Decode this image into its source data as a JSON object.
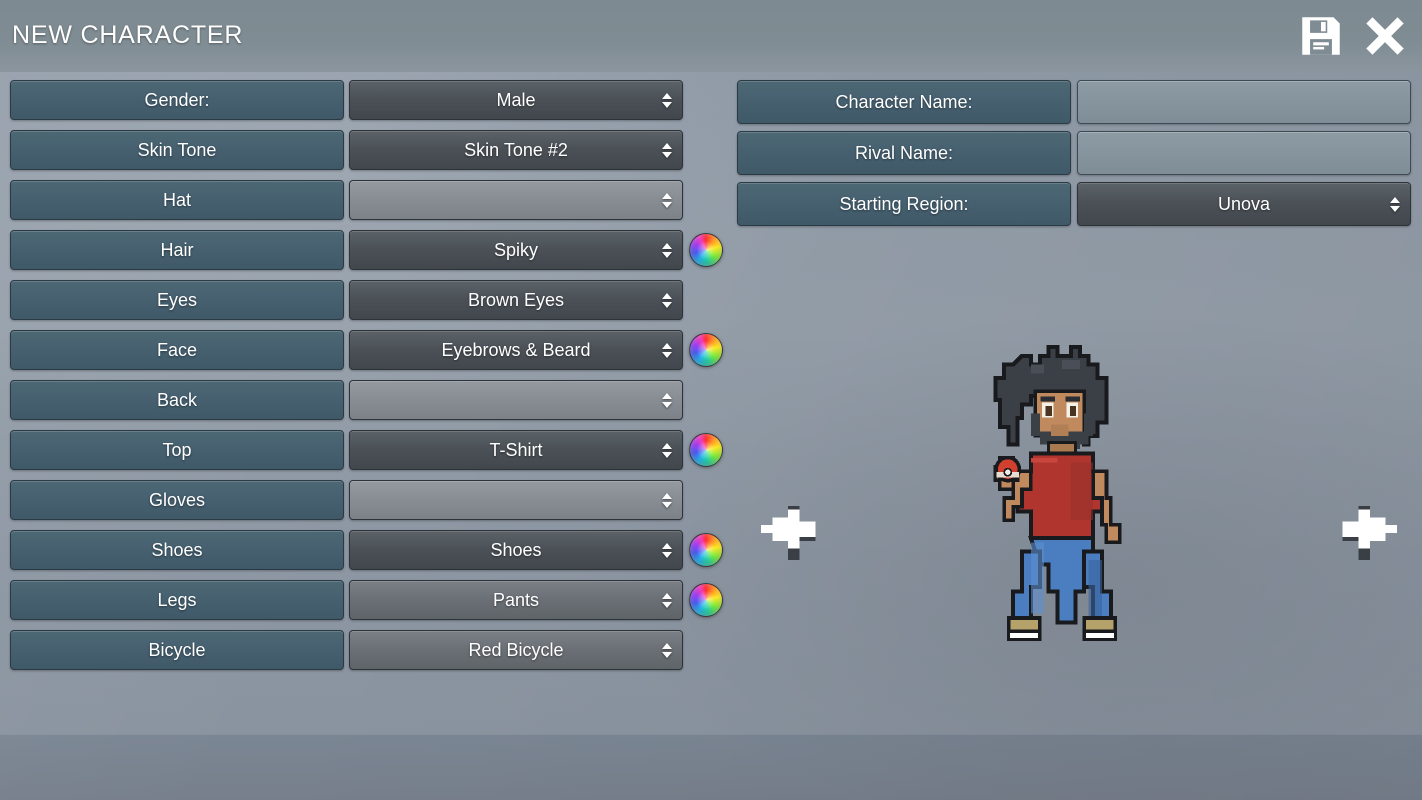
{
  "header": {
    "title": "NEW CHARACTER",
    "save_icon": "floppy-disk-save-icon",
    "close_icon": "close-x-icon"
  },
  "theme": {
    "label_button_color": "#466070",
    "select_color": "#4b5157",
    "select_empty_color": "#878d93",
    "text_input_color": "#86949e",
    "header_color": "#7f8c93",
    "background_color": "#949ea9",
    "floor_color": "#777f8c",
    "text_color": "#ffffff"
  },
  "appearance_rows": [
    {
      "label": "Gender:",
      "value": "Male",
      "empty": false,
      "light": false,
      "color_wheel": false
    },
    {
      "label": "Skin Tone",
      "value": "Skin Tone #2",
      "empty": false,
      "light": false,
      "color_wheel": false
    },
    {
      "label": "Hat",
      "value": "",
      "empty": true,
      "light": false,
      "color_wheel": false
    },
    {
      "label": "Hair",
      "value": "Spiky",
      "empty": false,
      "light": false,
      "color_wheel": true
    },
    {
      "label": "Eyes",
      "value": "Brown Eyes",
      "empty": false,
      "light": false,
      "color_wheel": false
    },
    {
      "label": "Face",
      "value": "Eyebrows & Beard",
      "empty": false,
      "light": false,
      "color_wheel": true
    },
    {
      "label": "Back",
      "value": "",
      "empty": true,
      "light": false,
      "color_wheel": false
    },
    {
      "label": "Top",
      "value": "T-Shirt",
      "empty": false,
      "light": false,
      "color_wheel": true
    },
    {
      "label": "Gloves",
      "value": "",
      "empty": true,
      "light": false,
      "color_wheel": false
    },
    {
      "label": "Shoes",
      "value": "Shoes",
      "empty": false,
      "light": false,
      "color_wheel": true
    },
    {
      "label": "Legs",
      "value": "Pants",
      "empty": false,
      "light": true,
      "color_wheel": true
    },
    {
      "label": "Bicycle",
      "value": "Red Bicycle",
      "empty": false,
      "light": true,
      "color_wheel": false
    }
  ],
  "identity_rows": [
    {
      "label": "Character Name:",
      "value": "",
      "placeholder": "",
      "kind": "text"
    },
    {
      "label": "Rival Name:",
      "value": "",
      "placeholder": "",
      "kind": "text"
    },
    {
      "label": "Starting Region:",
      "value": "Unova",
      "kind": "select"
    }
  ],
  "preview": {
    "prev_arrow": "arrow-left-icon",
    "next_arrow": "arrow-right-icon",
    "sprite_name": "character-preview-sprite",
    "sprite_colors": {
      "hair": "#3b3f46",
      "hair_shadow": "#2a2d33",
      "skin": "#c08a5e",
      "skin_shadow": "#a06f48",
      "beard": "#3b3f46",
      "shirt": "#b0352f",
      "shirt_shadow": "#8e2824",
      "pants": "#4a7ec0",
      "pants_shadow": "#3a64a0",
      "shoes": "#b5a26a",
      "shoes_sole": "#ffffff",
      "outline": "#181a1d",
      "pokeball": "#d1402e"
    }
  }
}
